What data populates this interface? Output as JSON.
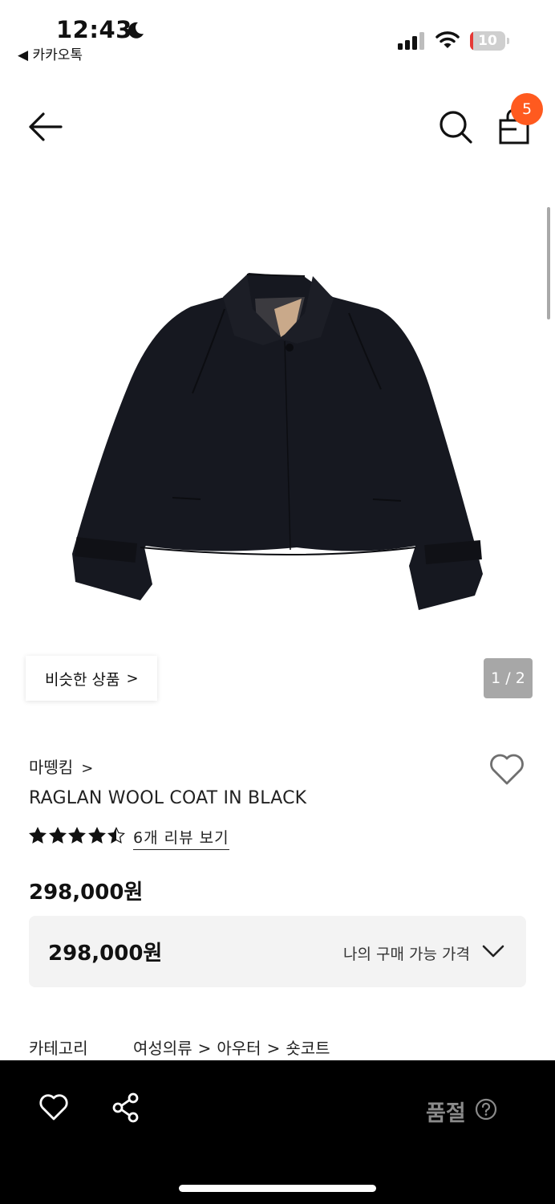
{
  "status_bar": {
    "time": "12:43",
    "back_app_label": "◀ 카카오톡",
    "battery_level": "10",
    "battery_fraction": 0.1,
    "battery_color": "#e53935"
  },
  "header": {
    "cart_count": "5",
    "badge_color": "#ff5a1f"
  },
  "gallery": {
    "similar_products_label": "비슷한 상품",
    "page_indicator": "1 / 2"
  },
  "product": {
    "brand": "마뗑킴",
    "name": "RAGLAN WOOL COAT IN BLACK",
    "rating": 4.5,
    "rating_max": 5,
    "review_link": "6개 리뷰 보기",
    "price": "298,000원"
  },
  "my_price": {
    "value": "298,000원",
    "label": "나의 구매 가능 가격"
  },
  "category": {
    "label": "카테고리",
    "path": [
      "여성의류",
      "아우터",
      "숏코트"
    ]
  },
  "bottom_bar": {
    "soldout_label": "품절"
  },
  "icons": [
    "back-arrow-icon",
    "search-icon",
    "shopping-bag-icon",
    "heart-icon",
    "share-icon",
    "help-icon",
    "chevron-down-icon",
    "star-icon"
  ]
}
